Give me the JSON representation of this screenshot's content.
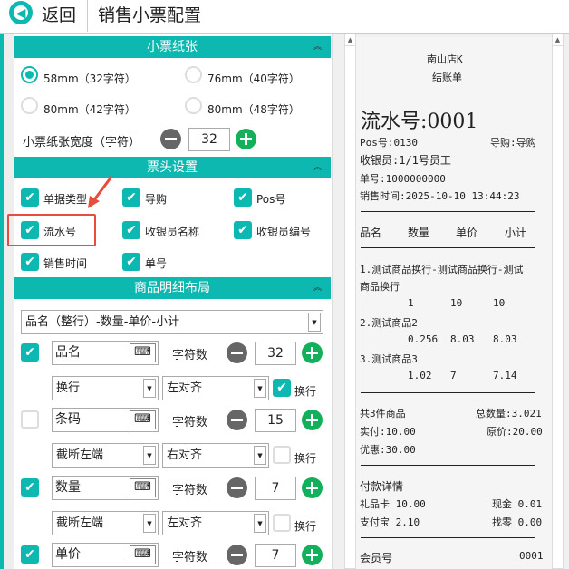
{
  "header": {
    "back": "返回",
    "title": "销售小票配置"
  },
  "paper": {
    "title": "小票纸张",
    "options": [
      "58mm（32字符）",
      "76mm（40字符）",
      "80mm（42字符）",
      "80mm（48字符）"
    ],
    "selected": 0,
    "width_label": "小票纸张宽度（字符）",
    "width_value": "32"
  },
  "head": {
    "title": "票头设置",
    "items": [
      {
        "label": "单据类型",
        "checked": true
      },
      {
        "label": "导购",
        "checked": true
      },
      {
        "label": "Pos号",
        "checked": true
      },
      {
        "label": "流水号",
        "checked": true
      },
      {
        "label": "收银员名称",
        "checked": true
      },
      {
        "label": "收银员编号",
        "checked": true
      },
      {
        "label": "销售时间",
        "checked": true
      },
      {
        "label": "单号",
        "checked": true
      }
    ]
  },
  "detail": {
    "title": "商品明细布局",
    "layout": "品名（整行）-数量-单价-小计",
    "char_label": "字符数",
    "wrap_label": "换行",
    "rows": [
      {
        "name": "品名",
        "checked": true,
        "chars": "32",
        "mode": "换行",
        "align": "左对齐",
        "wrap": true
      },
      {
        "name": "条码",
        "checked": false,
        "chars": "15",
        "mode": "截断左端",
        "align": "右对齐",
        "wrap": false
      },
      {
        "name": "数量",
        "checked": true,
        "chars": "7",
        "mode": "截断左端",
        "align": "左对齐",
        "wrap": false
      },
      {
        "name": "单价",
        "checked": true,
        "chars": "7"
      }
    ]
  },
  "receipt": {
    "store": "南山店K",
    "type": "结账单",
    "serial": "流水号:0001",
    "pos": "Pos号:0130",
    "guide": "导购:导购",
    "cashier": "收银员:1/1号员工",
    "order": "单号:1000000000",
    "time": "销售时间:2025-10-10 13:44:23",
    "cols": [
      "品名",
      "数量",
      "单价",
      "小计"
    ],
    "items": [
      {
        "name": "1.测试商品换行-测试商品换行-测试",
        "name2": "商品换行",
        "qty": "1",
        "price": "10",
        "sub": "10"
      },
      {
        "name": "2.测试商品2",
        "qty": "0.256",
        "price": "8.03",
        "sub": "8.03"
      },
      {
        "name": "3.测试商品3",
        "qty": "1.02",
        "price": "7",
        "sub": "7.14"
      }
    ],
    "count": "共3件商品",
    "total_qty": "总数量:3.021",
    "paid": "实付:10.00",
    "orig": "原价:20.00",
    "discount": "优惠:30.00",
    "pay_title": "付款详情",
    "gift": "礼品卡 10.00",
    "cash": "现金 0.01",
    "alipay": "支付宝 2.10",
    "change": "找零 0.00",
    "member": "会员号",
    "member_no": "0001"
  }
}
